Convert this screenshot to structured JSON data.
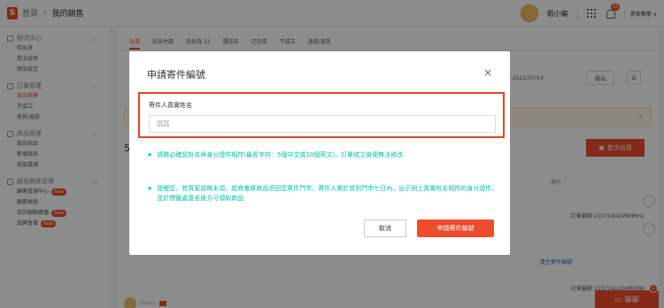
{
  "topbar": {
    "breadcrumb_home": "首頁",
    "breadcrumb_sep": "›",
    "breadcrumb_current": "我的銷售",
    "username": "蝦小編",
    "notification_count": "15",
    "language": "賣家教學 ∨"
  },
  "sidebar": {
    "groups": [
      {
        "title": "物流中心",
        "items": [
          "待出貨",
          "批次出貨",
          "物流設定"
        ]
      },
      {
        "title": "訂單管理",
        "items": [
          "我的銷售",
          "不成立",
          "退貨/退款"
        ]
      },
      {
        "title": "商品管理",
        "items": [
          "我的商品",
          "新增商品",
          "商品違規"
        ]
      },
      {
        "title": "顧客關係管理",
        "items": [
          "顧客管理中心",
          "顧客群組",
          "我的聊聊廣播",
          "品牌會員"
        ]
      }
    ],
    "new_label": "New"
  },
  "main": {
    "tabs": [
      "全部",
      "尚未付款",
      "待出貨 12",
      "運送中",
      "已完成",
      "不成立",
      "退款/退貨"
    ],
    "date_range": "~ 2021/07/14",
    "export_label": "匯出",
    "five_label": "5",
    "bulk_ship_label": "批次出貨",
    "action_header": "操作",
    "order_no_1": "訂單編號 210714U2VBMHH1",
    "print_link": "產生寄件編號",
    "shop_name": "Shrimp",
    "order_no_2": "訂單編號 210714U2SMRFRM",
    "notice_close": "×"
  },
  "chat": {
    "label": "聊聊",
    "badge": "1"
  },
  "modal": {
    "title": "申請寄件編號",
    "close": "×",
    "field_label": "寄件人真實姓名",
    "field_value": "沉沉",
    "star": "★",
    "note_1": "請務必確認姓名與身分證件相符(最長字符：5個中文或10個英文)，訂單成立後便無法修改",
    "note_2": "提醒您，若買家逾期未領，超商會將商品退回您寄件門市，寄件人需於貨到門市七日內，出示同上真實姓名相符的身分證件，並於標籤處簽名後方可領取商品",
    "cancel": "取消",
    "submit": "申請寄件編號"
  },
  "colors": {
    "brand": "#ee4d2d",
    "note": "#00bfa5",
    "highlight_border": "#e0442a"
  }
}
